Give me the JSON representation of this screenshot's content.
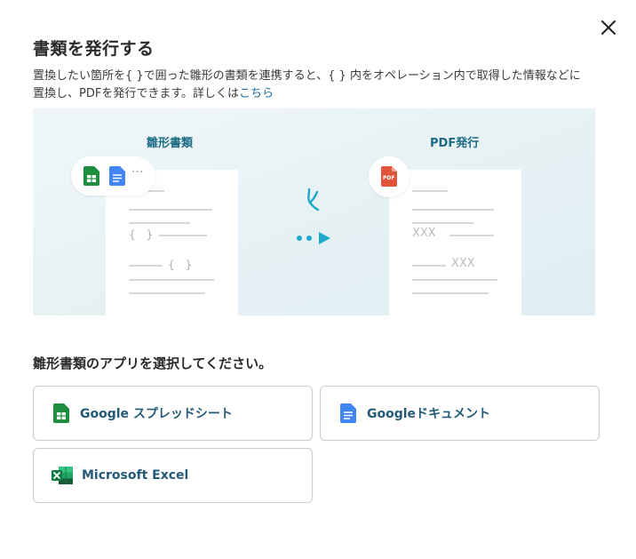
{
  "dialog": {
    "title": "書類を発行する",
    "description_line1": "置換したい箇所を{ }で囲った雛形の書類を連携すると、{ } 内をオペレーション内で取得した情報などに",
    "description_line2_prefix": "置換し、PDFを発行できます。詳しくは",
    "description_link": "こちら",
    "close_icon": "close-icon"
  },
  "illustration": {
    "left_label": "雛形書類",
    "right_label": "PDF発行",
    "template_placeholder_1": "{　}",
    "template_placeholder_2": "{　}",
    "output_placeholder_1": "XXX",
    "output_placeholder_2": "XXX",
    "pdf_badge": "PDF",
    "more_dots": "···"
  },
  "app_select": {
    "label": "雛形書類のアプリを選択してください。",
    "options": [
      {
        "label": "Google スプレッドシート",
        "icon": "google-sheets-icon",
        "color": "#1e8e3e"
      },
      {
        "label": "Googleドキュメント",
        "icon": "google-docs-icon",
        "color": "#4285f4"
      },
      {
        "label": "Microsoft Excel",
        "icon": "excel-icon",
        "color": "#1d6f42"
      }
    ]
  }
}
